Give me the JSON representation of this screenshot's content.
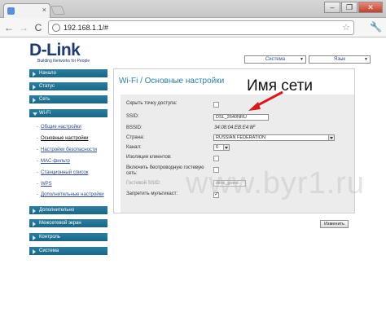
{
  "browser": {
    "tab_close": "×",
    "url": "192.168.1.1/#",
    "window_buttons": [
      "–",
      "❐",
      "✕"
    ],
    "nav_back": "←",
    "nav_forward": "→",
    "nav_reload": "C",
    "bookmark_icon": "star-icon",
    "menu_icon": "wrench-icon"
  },
  "brand": {
    "logo": "D-Link",
    "tagline": "Building Networks for People"
  },
  "top_selects": {
    "system": "Система",
    "language": "Язык"
  },
  "sidebar": {
    "items": [
      {
        "label": "Начало"
      },
      {
        "label": "Статус"
      },
      {
        "label": "Сеть"
      },
      {
        "label": "Wi-Fi"
      }
    ],
    "wifi_sub": [
      {
        "label": "Общие настройки",
        "active": false
      },
      {
        "label": "Основные настройки",
        "active": true
      },
      {
        "label": "Настройки безопасности",
        "active": false
      },
      {
        "label": "MAC-фильтр",
        "active": false
      },
      {
        "label": "Станционный список",
        "active": false
      },
      {
        "label": "WPS",
        "active": false
      },
      {
        "label": "Дополнительные настройки",
        "active": false
      }
    ],
    "items_after": [
      {
        "label": "Дополнительно"
      },
      {
        "label": "Межсетевой экран"
      },
      {
        "label": "Контроль"
      },
      {
        "label": "Система"
      }
    ]
  },
  "main": {
    "title": "Wi-Fi / Основные настройки",
    "fields": {
      "hide_ap_label": "Скрыть точку доступа:",
      "ssid_label": "SSID:",
      "ssid_value": "DSL_2640NRU",
      "bssid_label": "BSSID:",
      "bssid_value": "34:08:04:EB:E4:8F",
      "country_label": "Страна:",
      "country_value": "RUSSIAN FEDERATION",
      "channel_label": "Канал:",
      "channel_value": "6",
      "isolation_label": "Изоляция клиентов:",
      "guest_enable_label_1": "Включить беспроводную гостевую",
      "guest_enable_label_2": "сеть:",
      "guest_ssid_label": "Гостевой SSID:",
      "guest_ssid_value": "dlink_guest",
      "multicast_label": "Запретить мультикаст:"
    },
    "checkboxes": {
      "hide_ap": false,
      "isolation": false,
      "guest_enable": false,
      "multicast": true
    },
    "apply_button": "Изменить"
  },
  "annotation": {
    "text": "Имя сети"
  },
  "watermark": "www.byr1.ru"
}
